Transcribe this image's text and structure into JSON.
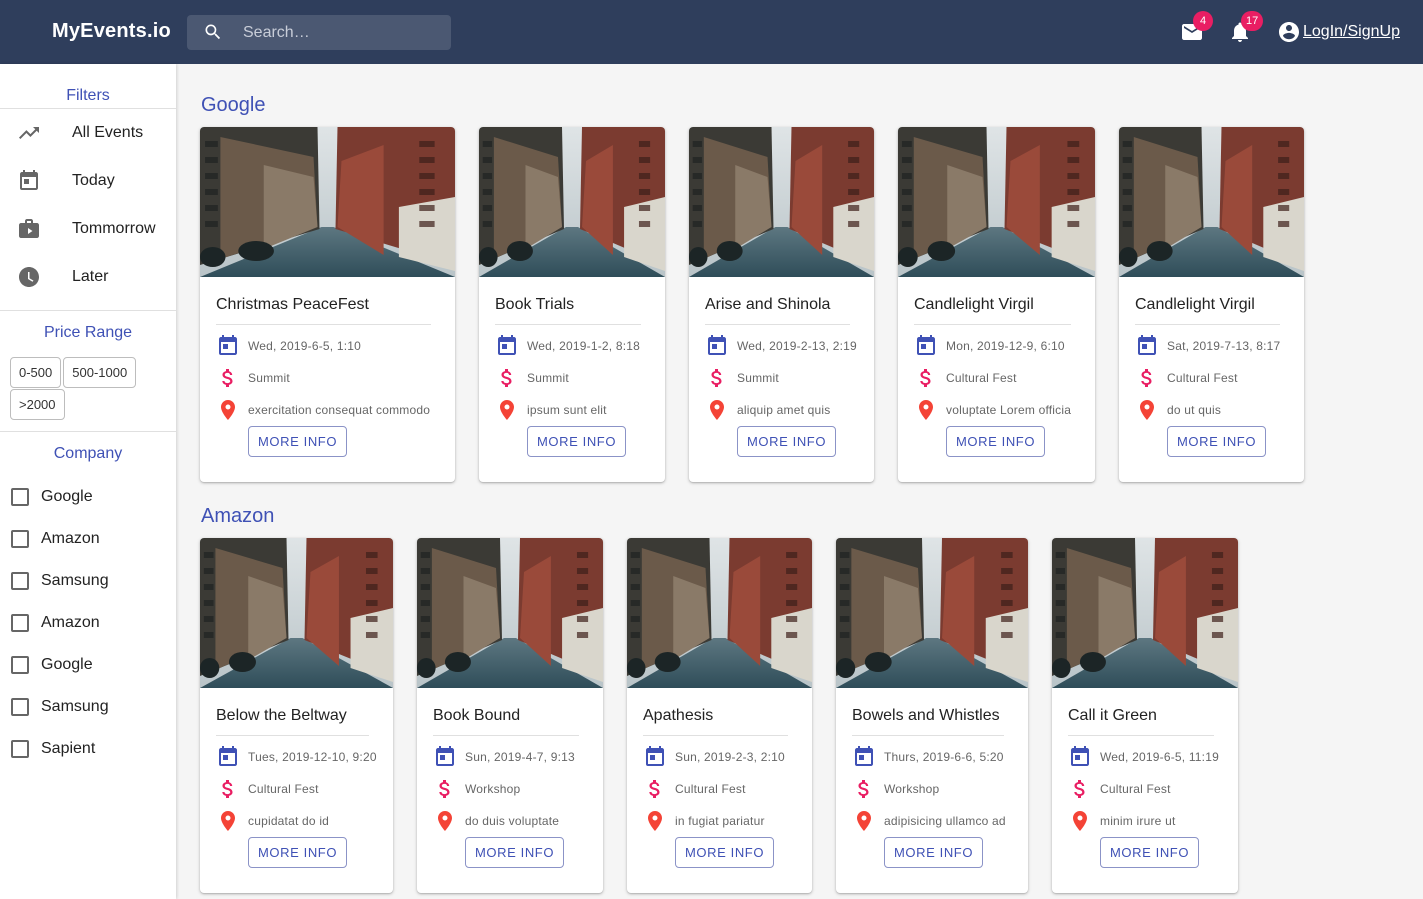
{
  "app": {
    "title": "MyEvents.io",
    "search_placeholder": "Search…",
    "mail_badge": "4",
    "notifications_badge": "17",
    "login_label": "LogIn/SignUp"
  },
  "sidebar": {
    "filters_title": "Filters",
    "filters": [
      {
        "label": "All Events",
        "icon": "trending-up-icon"
      },
      {
        "label": "Today",
        "icon": "calendar-today-icon"
      },
      {
        "label": "Tommorrow",
        "icon": "work-briefcase-icon"
      },
      {
        "label": "Later",
        "icon": "clock-icon"
      }
    ],
    "price_title": "Price Range",
    "price_ranges": [
      "0-500",
      "500-1000",
      ">2000"
    ],
    "company_title": "Company",
    "companies": [
      "Google",
      "Amazon",
      "Samsung",
      "Amazon",
      "Google",
      "Samsung",
      "Sapient"
    ]
  },
  "groups": [
    {
      "name": "Google",
      "events": [
        {
          "title": "Christmas PeaceFest",
          "date": "Wed, 2019-6-5, 1:10",
          "type": "Summit",
          "location": "exercitation consequat commodo"
        },
        {
          "title": "Book Trials",
          "date": "Wed, 2019-1-2, 8:18",
          "type": "Summit",
          "location": "ipsum sunt elit"
        },
        {
          "title": "Arise and Shinola",
          "date": "Wed, 2019-2-13, 2:19",
          "type": "Summit",
          "location": "aliquip amet quis"
        },
        {
          "title": "Candlelight Virgil",
          "date": "Mon, 2019-12-9, 6:10",
          "type": "Cultural Fest",
          "location": "voluptate Lorem officia"
        },
        {
          "title": "Candlelight Virgil",
          "date": "Sat, 2019-7-13, 8:17",
          "type": "Cultural Fest",
          "location": "do ut quis"
        }
      ]
    },
    {
      "name": "Amazon",
      "events": [
        {
          "title": "Below the Beltway",
          "date": "Tues, 2019-12-10, 9:20",
          "type": "Cultural Fest",
          "location": "cupidatat do id"
        },
        {
          "title": "Book Bound",
          "date": "Sun, 2019-4-7, 9:13",
          "type": "Workshop",
          "location": "do duis voluptate"
        },
        {
          "title": "Apathesis",
          "date": "Sun, 2019-2-3, 2:10",
          "type": "Cultural Fest",
          "location": "in fugiat pariatur"
        },
        {
          "title": "Bowels and Whistles",
          "date": "Thurs, 2019-6-6, 5:20",
          "type": "Workshop",
          "location": "adipisicing ullamco ad"
        },
        {
          "title": "Call it Green",
          "date": "Wed, 2019-6-5, 11:19",
          "type": "Cultural Fest",
          "location": "minim irure ut"
        }
      ]
    }
  ],
  "card_button_label": "MORE INFO",
  "colors": {
    "appbar": "#2f3e5c",
    "primary": "#3f51b5",
    "accent": "#e91e63",
    "location": "#f44336"
  }
}
